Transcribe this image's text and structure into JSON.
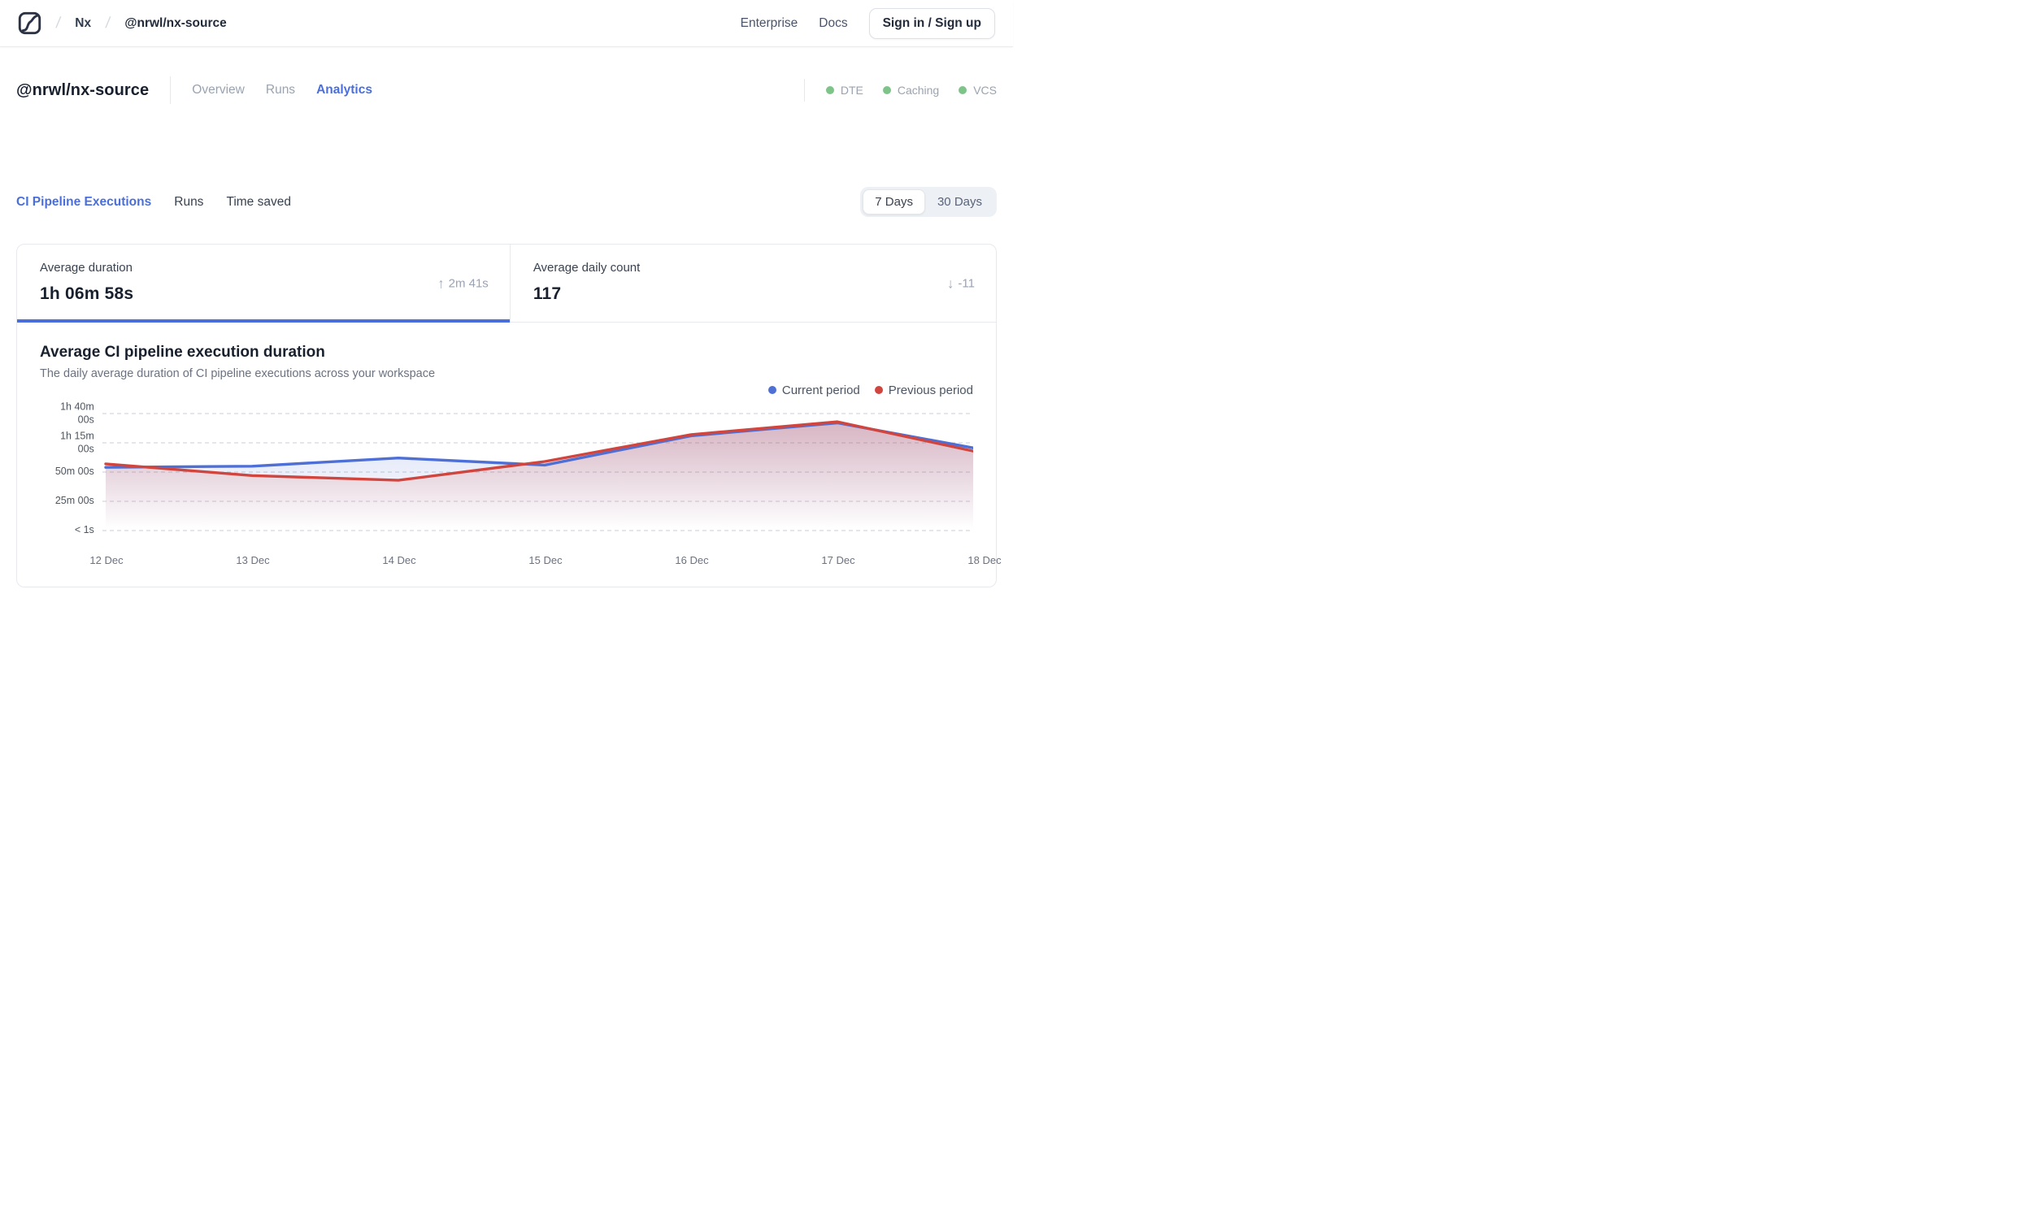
{
  "nav": {
    "breadcrumb": {
      "sep": "/",
      "org": "Nx",
      "workspace": "@nrwl/nx-source"
    },
    "links": {
      "enterprise": "Enterprise",
      "docs": "Docs"
    },
    "signin_label": "Sign in / Sign up"
  },
  "workspace_header": {
    "title": "@nrwl/nx-source",
    "tabs": [
      {
        "label": "Overview",
        "active": false
      },
      {
        "label": "Runs",
        "active": false
      },
      {
        "label": "Analytics",
        "active": true
      }
    ],
    "status_items": [
      {
        "label": "DTE",
        "dot_color": "#7ec488"
      },
      {
        "label": "Caching",
        "dot_color": "#7ec488"
      },
      {
        "label": "VCS",
        "dot_color": "#7ec488"
      }
    ]
  },
  "metric_tabs": [
    {
      "label": "CI Pipeline Executions",
      "active": true
    },
    {
      "label": "Runs",
      "active": false
    },
    {
      "label": "Time saved",
      "active": false
    }
  ],
  "range_toggle": {
    "options": [
      "7 Days",
      "30 Days"
    ],
    "selected": "7 Days"
  },
  "stat_cards": [
    {
      "label": "Average duration",
      "value": "1h 06m 58s",
      "delta_arrow": "↑",
      "delta_text": "2m 41s",
      "active": true
    },
    {
      "label": "Average daily count",
      "value": "117",
      "delta_arrow": "↓",
      "delta_text": "-11",
      "active": false
    }
  ],
  "chart": {
    "title": "Average CI pipeline execution duration",
    "subtitle": "The daily average duration of CI pipeline executions across your workspace"
  },
  "chart_data": {
    "type": "line",
    "title": "Average CI pipeline execution duration",
    "x": [
      "12 Dec",
      "13 Dec",
      "14 Dec",
      "15 Dec",
      "16 Dec",
      "17 Dec",
      "18 Dec"
    ],
    "unit": "minutes",
    "series": [
      {
        "name": "Current period",
        "color": "#4e6fd6",
        "values": [
          54,
          55,
          62,
          56,
          81,
          92,
          69
        ]
      },
      {
        "name": "Previous period",
        "color": "#d1453f",
        "values": [
          57,
          47,
          43,
          59,
          82,
          93,
          66
        ]
      }
    ],
    "y_ticks": [
      {
        "label": "1h 40m\n00s",
        "value": 100
      },
      {
        "label": "1h 15m\n00s",
        "value": 75
      },
      {
        "label": "50m 00s",
        "value": 50
      },
      {
        "label": "25m 00s",
        "value": 25
      },
      {
        "label": "< 1s",
        "value": 0
      }
    ],
    "ylim": [
      0,
      100
    ],
    "grid": "dashed-horizontal",
    "legend_position": "top-right",
    "area_fill": true
  }
}
